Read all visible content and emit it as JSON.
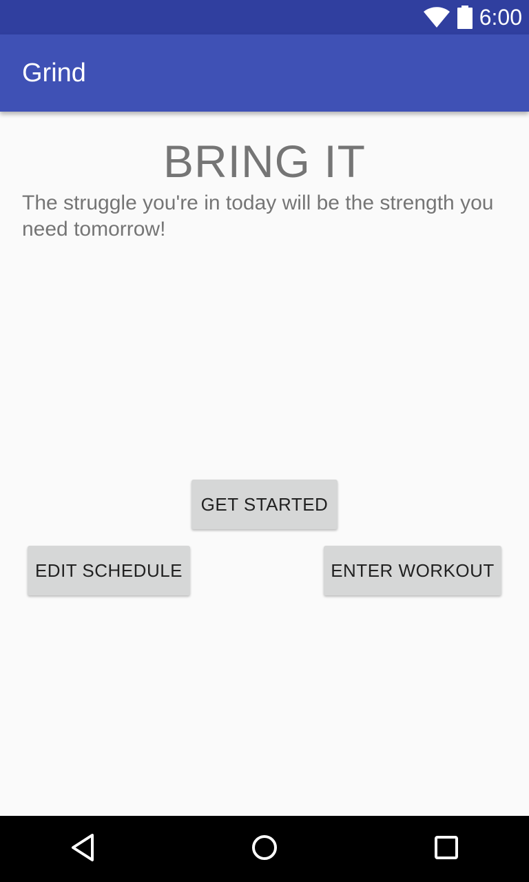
{
  "status_bar": {
    "time": "6:00",
    "icons": [
      "wifi-icon",
      "battery-icon"
    ],
    "background": "#303f9f"
  },
  "app_bar": {
    "title": "Grind",
    "background": "#3f51b5"
  },
  "main": {
    "headline": "BRING IT",
    "quote": "The struggle you're in today will be the strength you need tomorrow!",
    "buttons": {
      "get_started": "GET STARTED",
      "edit_schedule": "EDIT SCHEDULE",
      "enter_workout": "ENTER WORKOUT"
    }
  },
  "nav_bar": {
    "icons": [
      "back-icon",
      "home-icon",
      "recents-icon"
    ]
  }
}
